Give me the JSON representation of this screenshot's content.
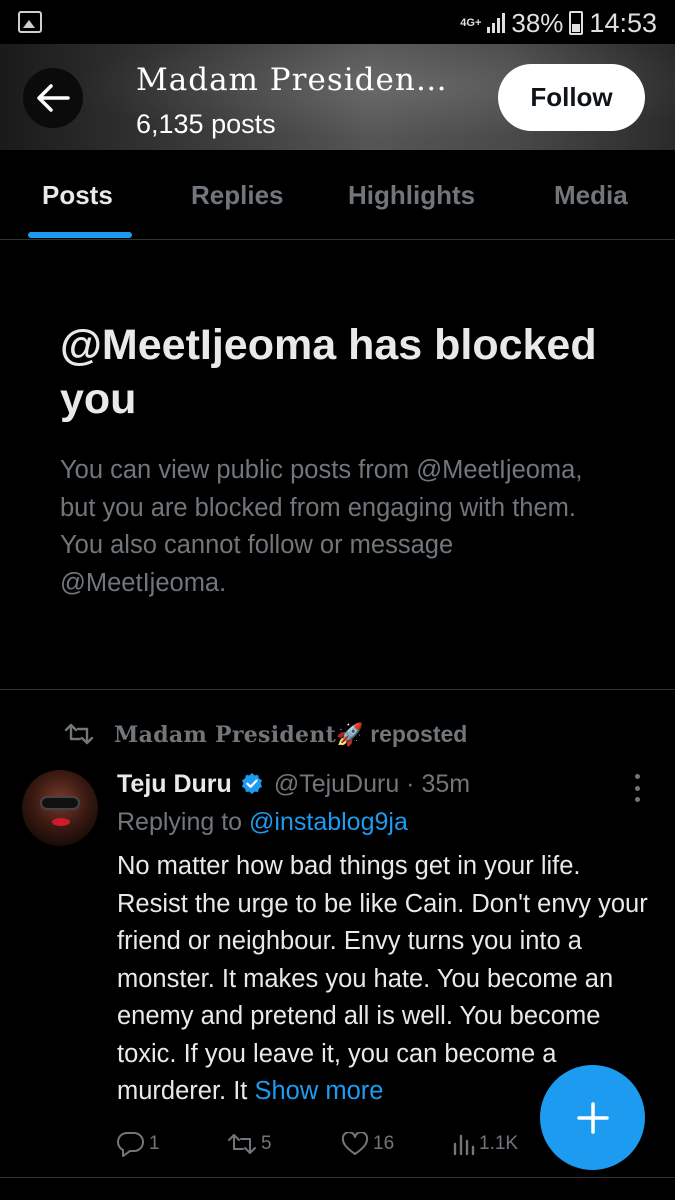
{
  "status_bar": {
    "network": "4G+",
    "battery_percent": "38%",
    "time": "14:53"
  },
  "header": {
    "title": "Madam Presiden…",
    "post_count": "6,135 posts",
    "follow_label": "Follow"
  },
  "tabs": [
    {
      "label": "Posts",
      "active": true
    },
    {
      "label": "Replies",
      "active": false
    },
    {
      "label": "Highlights",
      "active": false
    },
    {
      "label": "Media",
      "active": false
    }
  ],
  "blocked": {
    "title": "@MeetIjeoma has blocked you",
    "description": "You can view public posts from @MeetIjeoma, but you are blocked from engaging with them. You also cannot follow or message @MeetIjeoma."
  },
  "post": {
    "repost_by": "Madam President🚀",
    "repost_suffix": "reposted",
    "author_name": "Teju Duru",
    "handle_time": "@TejuDuru · 35m",
    "replying_prefix": "Replying to",
    "replying_to": "@instablog9ja",
    "text": "No matter how bad things get in your life. Resist the urge to be like Cain. Don't envy your friend or neighbour. Envy turns you into a monster. It makes you hate. You become an enemy and pretend all is well. You become toxic. If you leave it, you can become a murderer. It ",
    "show_more": "Show more",
    "stats": {
      "replies": "1",
      "reposts": "5",
      "likes": "16",
      "views": "1.1K"
    }
  },
  "colors": {
    "accent": "#1d9bf0",
    "background": "#000000",
    "muted_text": "#71767b"
  }
}
